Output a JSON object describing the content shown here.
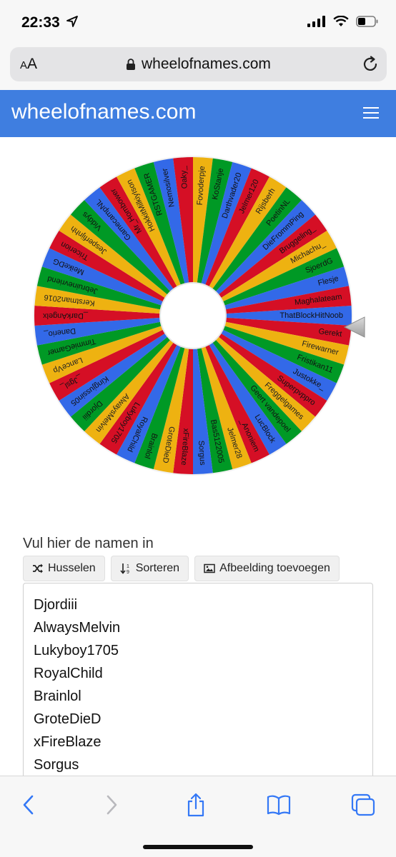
{
  "status": {
    "time": "22:33",
    "icons": [
      "location-arrow-icon",
      "cellular-signal-icon",
      "wifi-icon",
      "battery-icon"
    ]
  },
  "browser": {
    "aa_label_small": "A",
    "aa_label_large": "A",
    "url": "wheelofnames.com",
    "toolbar_icons": [
      "back-icon",
      "forward-icon",
      "share-icon",
      "bookmarks-icon",
      "tabs-icon"
    ]
  },
  "site": {
    "title": "wheelofnames.com",
    "header_color": "#3f7ee0"
  },
  "wheel": {
    "colors": [
      "#3369e8",
      "#d50f25",
      "#eeb211",
      "#009925"
    ],
    "selected_pointer_name": "ThatBlockHitNoob",
    "segments": [
      "ThatBlockHitNoob",
      "Gerekt",
      "Firewarner",
      "Fristikan11",
      "Justokke_",
      "Superpvppro",
      "Freggelgames",
      "Geert vandepoel",
      "LucBlock",
      "_Anoniem",
      "Jelmer28",
      "Bas5122005",
      "Sorgus",
      "xFireBlaze",
      "GroteDieD",
      "Brainlol",
      "RoyalChild",
      "Lukyboy1705",
      "AlwaysMelvin",
      "Djordiii",
      "Kingjussin05",
      "_Jgsl_",
      "LanceVp",
      "TimmieGamer",
      "Danerio_",
      "_DarkAngelx",
      "Kerstman2016",
      "Jebruinevriend",
      "MeikeDG",
      "Tricerion",
      "Jesperfijnhh",
      "Viddys",
      "GamecampNL",
      "Mr_Hombower",
      "HokkitMilkiyIson",
      "RSTGAMER",
      "Nemosilver",
      "Oaky_",
      "Fovoderpje",
      "KoStanje",
      "Darthvader20",
      "Jelmer120",
      "Rijsberh",
      "PoetinNL",
      "DieFrommPing",
      "Bruggeling_",
      "Michachu_",
      "SjoerdG",
      "Flesje",
      "Maghalateam"
    ]
  },
  "names": {
    "label": "Vul hier de namen in",
    "buttons": {
      "shuffle": "Husselen",
      "sort": "Sorteren",
      "add_image": "Afbeelding toevoegen"
    },
    "entries": [
      "Djordiii",
      "AlwaysMelvin",
      "Lukyboy1705",
      "RoyalChild",
      "Brainlol",
      "GroteDieD",
      "xFireBlaze",
      "Sorgus"
    ]
  }
}
